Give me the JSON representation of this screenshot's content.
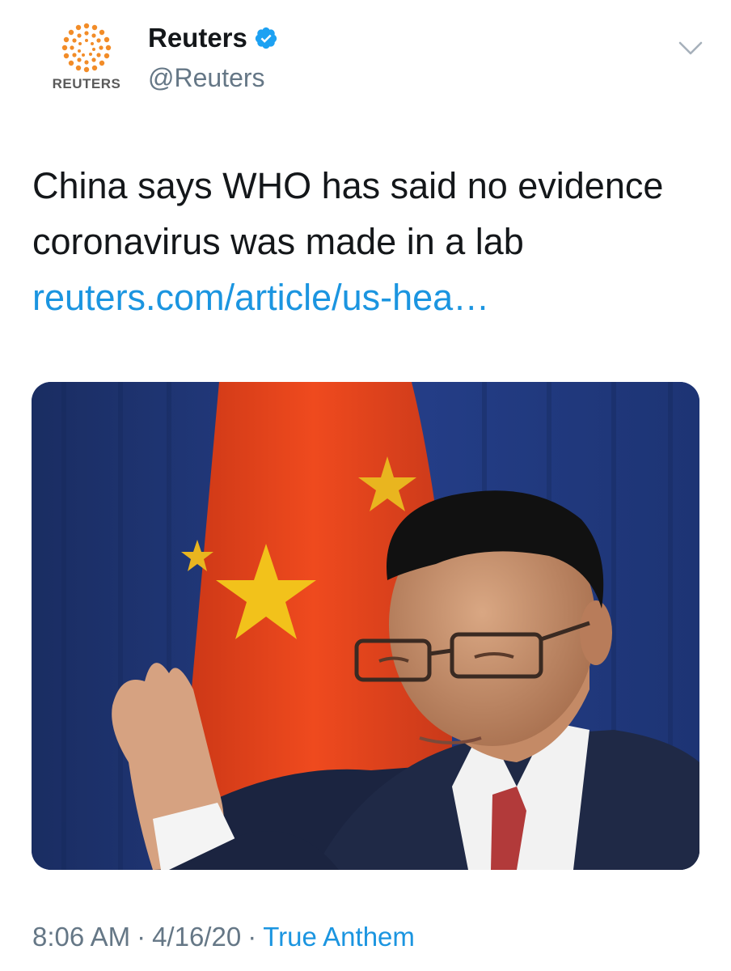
{
  "author": {
    "display_name": "Reuters",
    "handle": "@Reuters",
    "avatar_wordmark": "REUTERS",
    "verified_icon": "verified-badge-icon"
  },
  "tweet": {
    "text": "China says WHO has said no evidence coronavirus was made in a lab ",
    "link_text": "reuters.com/article/us-hea…"
  },
  "meta": {
    "time": "8:06 AM",
    "separator": "·",
    "date": "4/16/20",
    "source": "True Anthem"
  },
  "media": {
    "description_icon": "photo-image"
  },
  "colors": {
    "link": "#1b95e0",
    "secondary_text": "#657786",
    "verified": "#1da1f2",
    "reuters_orange": "#f28c28"
  }
}
